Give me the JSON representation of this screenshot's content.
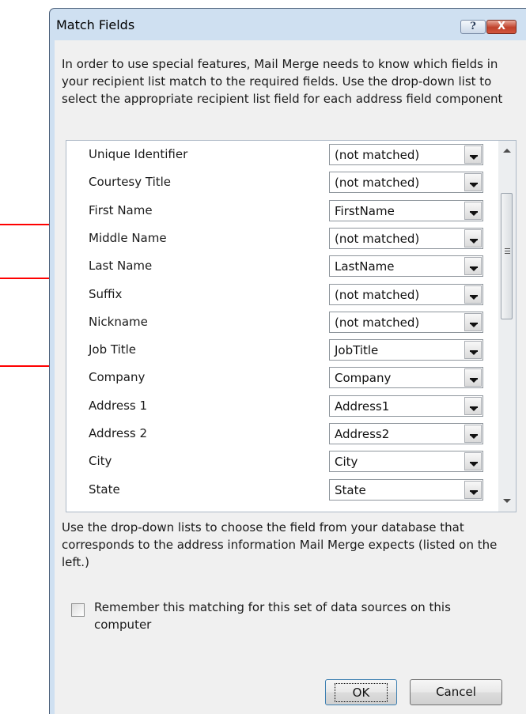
{
  "window": {
    "title": "Match Fields",
    "help_button": "?",
    "close_button": "X"
  },
  "description": "In order to use special features, Mail Merge needs to know which fields in your recipient list match to the required fields.  Use the drop-down list to select the appropriate recipient list field for each address field component",
  "fields": [
    {
      "label": "Unique Identifier",
      "value": "(not matched)"
    },
    {
      "label": "Courtesy Title",
      "value": "(not matched)"
    },
    {
      "label": "First Name",
      "value": "FirstName"
    },
    {
      "label": "Middle Name",
      "value": "(not matched)"
    },
    {
      "label": "Last Name",
      "value": "LastName"
    },
    {
      "label": "Suffix",
      "value": "(not matched)"
    },
    {
      "label": "Nickname",
      "value": "(not matched)"
    },
    {
      "label": "Job Title",
      "value": "JobTitle"
    },
    {
      "label": "Company",
      "value": "Company"
    },
    {
      "label": "Address 1",
      "value": "Address1"
    },
    {
      "label": "Address 2",
      "value": "Address2"
    },
    {
      "label": "City",
      "value": "City"
    },
    {
      "label": "State",
      "value": "State"
    }
  ],
  "highlighted_fields": [
    "First Name",
    "Last Name",
    "Job Title"
  ],
  "footer_description": "Use the drop-down lists to choose the field from your database that corresponds to the address information Mail Merge expects (listed on the left.)",
  "remember_checkbox": {
    "label": "Remember this matching for this set of data sources on this computer",
    "checked": false
  },
  "buttons": {
    "ok": "OK",
    "cancel": "Cancel"
  },
  "colors": {
    "annotation_arrow": "#ff0000",
    "title_bar": "#cfe0f1"
  }
}
